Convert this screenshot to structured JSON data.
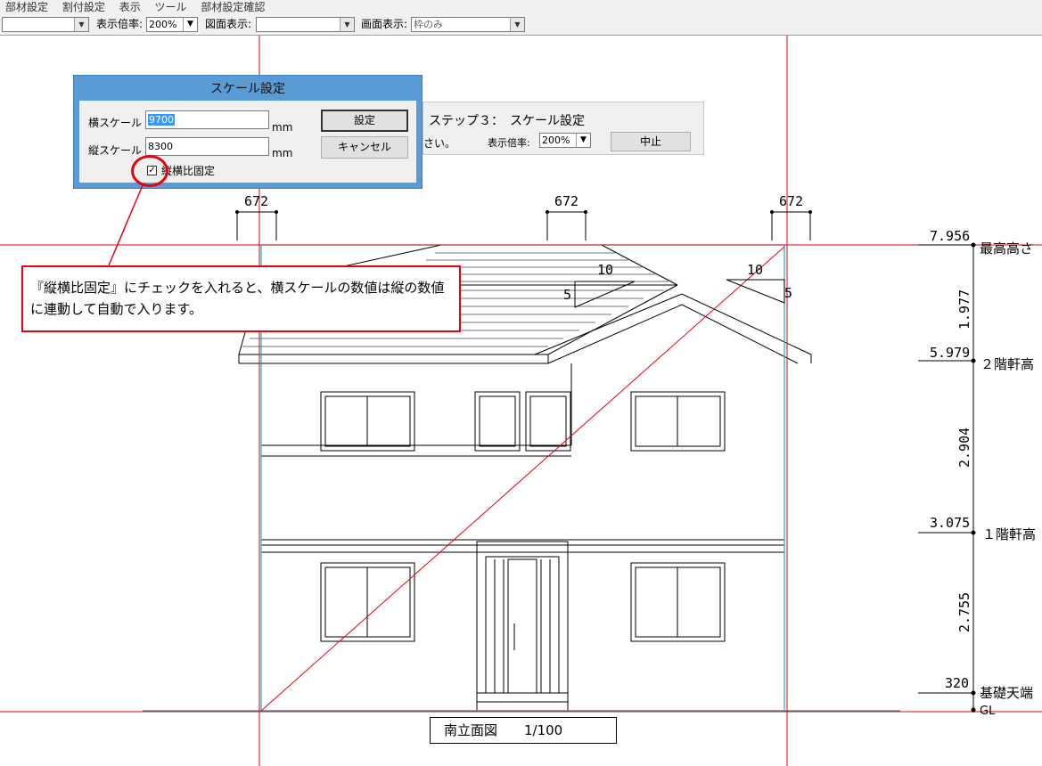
{
  "menu": [
    "部材設定",
    "割付設定",
    "表示",
    "ツール",
    "部材設定確認"
  ],
  "toolbar": {
    "zoom_label": "表示倍率:",
    "zoom_value": "200%",
    "drawing_label": "図面表示:",
    "drawing_value": "",
    "screen_label": "画面表示:",
    "screen_value": "枠のみ",
    "left_combo_value": ""
  },
  "scale_dialog": {
    "title": "スケール設定",
    "horizontal_label": "横スケール",
    "horizontal_value": "9700",
    "vertical_label": "縦スケール",
    "vertical_value": "8300",
    "unit": "mm",
    "set_button": "設定",
    "cancel_button": "キャンセル",
    "lock_ratio_label": "縦横比固定",
    "lock_ratio_checked": true
  },
  "step_panel": {
    "title": "ステップ３：　スケール設定",
    "instruction_fragment": "さい。",
    "zoom_label": "表示倍率:",
    "zoom_value": "200%",
    "stop_button": "中止"
  },
  "callout": {
    "text": "『縦横比固定』にチェックを入れると、横スケールの数値は縦の数値に連動して自動で入ります。",
    "border_color": "#e60012"
  },
  "drawing": {
    "dim_top": [
      "672",
      "672",
      "672"
    ],
    "roof_pitch": [
      {
        "run": "10",
        "rise": "5"
      },
      {
        "run": "10",
        "rise": "5"
      }
    ],
    "levels": [
      {
        "value": "7.956",
        "name": "最高高さ"
      },
      {
        "value": "5.979",
        "name": "２階軒高"
      },
      {
        "value": "3.075",
        "name": "１階軒高"
      },
      {
        "value": "320",
        "name": "基礎天端"
      },
      {
        "value": "320",
        "name": "GL"
      }
    ],
    "vertical_dims": [
      "1.977",
      "2.904",
      "2.755"
    ],
    "title": "南立面図　　1/100",
    "guide_color": "#e60012",
    "frame_color": "#00b7c3"
  }
}
